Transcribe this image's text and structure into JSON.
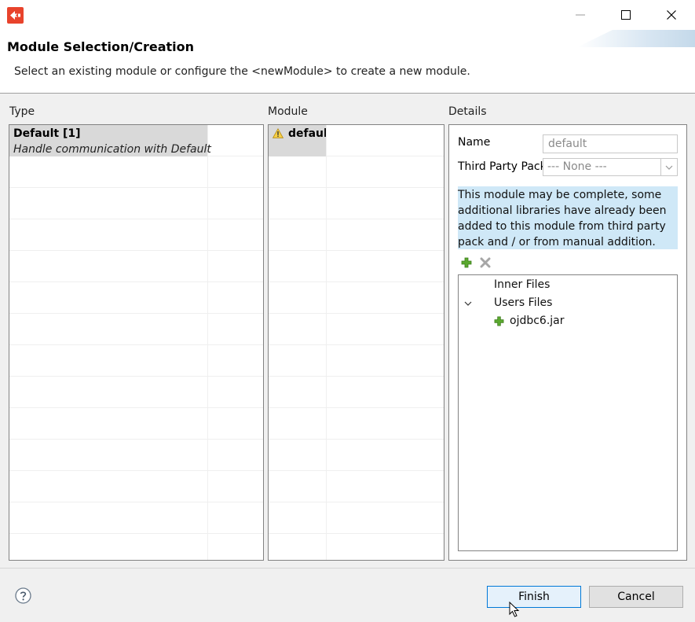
{
  "window": {
    "minimize_label": "minimize",
    "maximize_label": "maximize",
    "close_label": "close"
  },
  "header": {
    "title": "Module Selection/Creation",
    "description": "Select an existing module or configure the <newModule> to create a new module."
  },
  "type_panel": {
    "label": "Type",
    "selected": {
      "name": "Default [1]",
      "description": "Handle communication with Default"
    }
  },
  "module_panel": {
    "label": "Module",
    "selected": {
      "name": "default"
    }
  },
  "details": {
    "label": "Details",
    "name_label": "Name",
    "name_value": "default",
    "third_party_label": "Third Party Pack",
    "third_party_value": "--- None ---",
    "info_lines": [
      "This module may be complete, some",
      "additional libraries have already been",
      "added to this module from third party",
      "pack and / or from manual addition."
    ],
    "tree": {
      "inner_files": "Inner Files",
      "users_files": "Users Files",
      "file": "ojdbc6.jar"
    }
  },
  "footer": {
    "finish_label": "Finish",
    "cancel_label": "Cancel"
  },
  "colors": {
    "accent": "#0078d7",
    "selection": "#d9d9d9",
    "info_bg": "#cfe8f7",
    "add_green": "#5aa82f"
  }
}
